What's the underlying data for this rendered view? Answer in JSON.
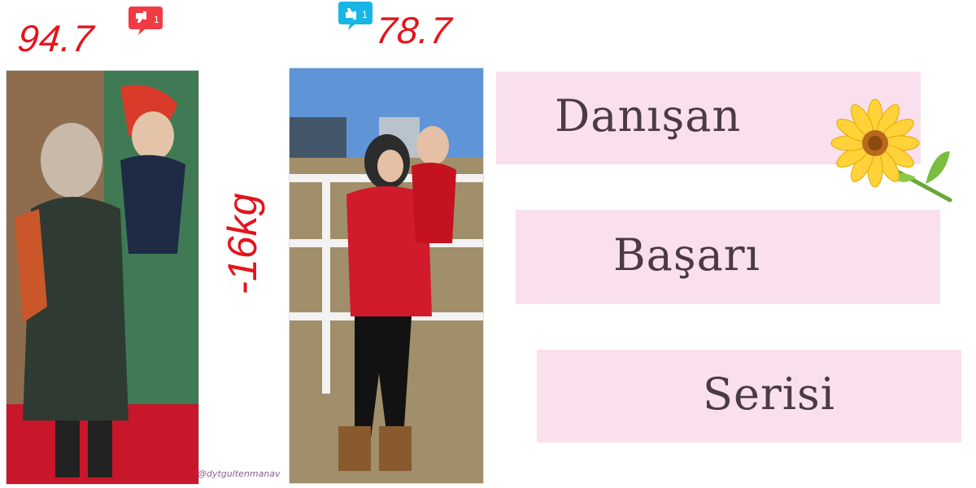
{
  "weights": {
    "before": "94.7",
    "after": "78.7"
  },
  "loss": "-16kg",
  "badges": {
    "dislike_icon": "thumbs-down-icon",
    "dislike_count": "1",
    "like_icon": "thumbs-up-icon",
    "like_count": "1"
  },
  "watermark": "@dytgultenmanav",
  "titles": [
    "Danışan",
    "Başarı",
    "Serisi"
  ],
  "colors": {
    "accent_red": "#e4141c",
    "title_box": "#f9e0ec",
    "title_text": "#4a3a48",
    "like_blue": "#19b5e6"
  }
}
